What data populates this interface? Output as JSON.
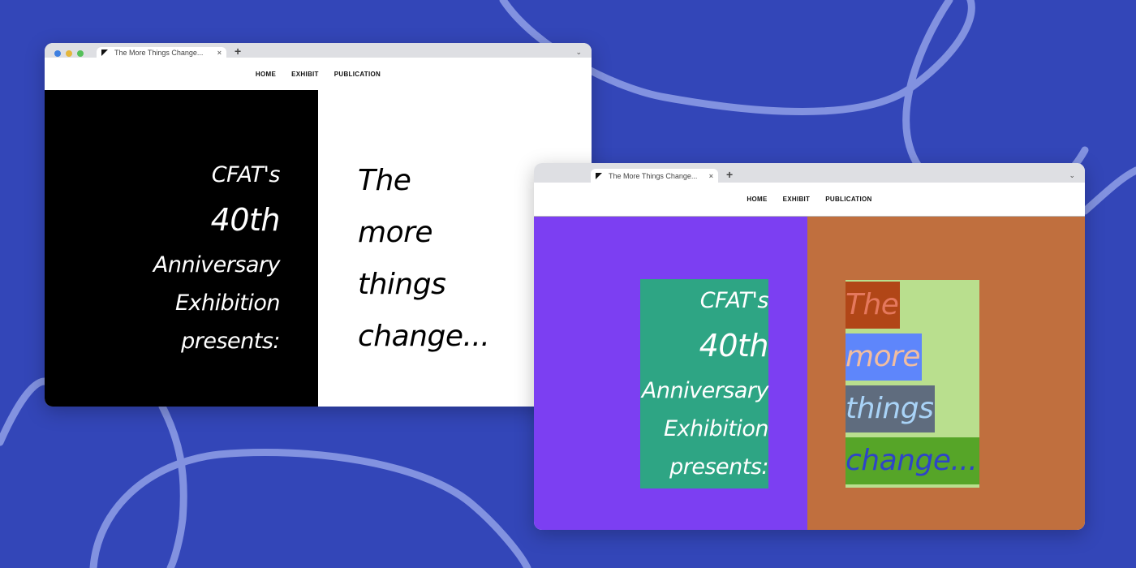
{
  "background": {
    "color": "#3346b8",
    "squiggle_color": "#8292e0"
  },
  "windows": [
    {
      "tab_title": "The More Things Change...",
      "tab_close": "×",
      "new_tab": "+",
      "dropdown": "⌄",
      "nav": [
        "HOME",
        "EXHIBIT",
        "PUBLICATION"
      ],
      "presents": [
        "CFAT's",
        "40th",
        "Anniversary",
        "Exhibition",
        "presents:"
      ],
      "title": [
        "The",
        "more",
        "things",
        "change..."
      ],
      "colors": {
        "left": "#000000",
        "right": "#ffffff"
      }
    },
    {
      "tab_title": "The More Things Change...",
      "tab_close": "×",
      "new_tab": "+",
      "dropdown": "⌄",
      "nav": [
        "HOME",
        "EXHIBIT",
        "PUBLICATION"
      ],
      "presents": [
        "CFAT's",
        "40th",
        "Anniversary",
        "Exhibition",
        "presents:"
      ],
      "title": [
        "The",
        "more",
        "things",
        "change..."
      ],
      "colors": {
        "left": "#7c3ff2",
        "right": "#c06f3e",
        "presents_box": "#2ea584",
        "title_box": "#b9df8e"
      }
    }
  ]
}
